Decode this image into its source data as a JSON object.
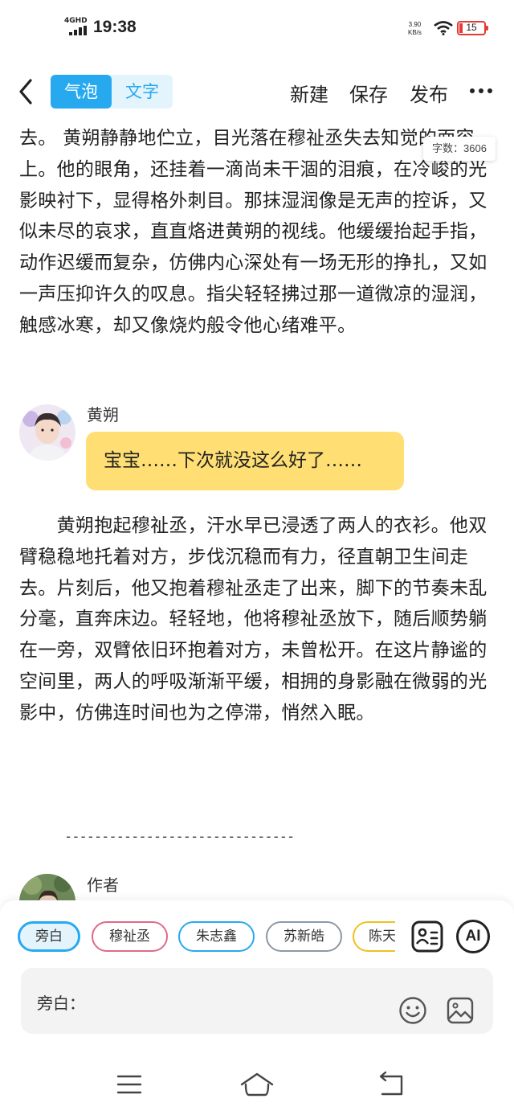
{
  "status_bar": {
    "network": "4GHD",
    "time": "19:38",
    "speed_value": "3.90",
    "speed_unit": "KB/s",
    "battery": "15",
    "battery_color": "#e53935"
  },
  "header": {
    "tab_bubble": "气泡",
    "tab_text": "文字",
    "new_label": "新建",
    "save_label": "保存",
    "publish_label": "发布",
    "accent_color": "#27a9f0"
  },
  "content": {
    "word_count": "字数：3606",
    "para1": "去。 黄朔静静地伫立，目光落在穆祉丞失去知觉的面容上。他的眼角，还挂着一滴尚未干涸的泪痕，在冷峻的光影映衬下，显得格外刺目。那抹湿润像是无声的控诉，又似未尽的哀求，直直烙进黄朔的视线。他缓缓抬起手指，动作迟缓而复杂，仿佛内心深处有一场无形的挣扎，又如一声压抑许久的叹息。指尖轻轻拂过那一道微凉的湿润，触感冰寒，却又像烧灼般令他心绪难平。",
    "speaker1": "黄朔",
    "bubble1": "宝宝……下次就没这么好了……",
    "bubble_color": "#ffdf73",
    "para2": "　　黄朔抱起穆祉丞，汗水早已浸透了两人的衣衫。他双臂稳稳地托着对方，步伐沉稳而有力，径直朝卫生间走去。片刻后，他又抱着穆祉丞走了出来，脚下的节奏未乱分毫，直奔床边。轻轻地，他将穆祉丞放下，随后顺势躺在一旁，双臂依旧环抱着对方，未曾松开。在这片静谧的空间里，两人的呼吸渐渐平缓，相拥的身影融在微弱的光影中，仿佛连时间也为之停滞，悄然入眠。",
    "divider": "-------------------------------",
    "speaker2": "作者"
  },
  "roles": [
    {
      "label": "旁白",
      "color": "#27a9f0"
    },
    {
      "label": "穆祉丞",
      "color": "#e06a8a"
    },
    {
      "label": "朱志鑫",
      "color": "#27a9f0"
    },
    {
      "label": "苏新皓",
      "color": "#8a9aa8"
    },
    {
      "label": "陈天",
      "color": "#f0c020"
    }
  ],
  "input": {
    "label": "旁白："
  },
  "icons": {
    "back": "chevron-left-icon",
    "more": "more-horizontal-icon",
    "contact_card": "contact-card-icon",
    "ai": "ai-icon",
    "emoji": "emoji-icon",
    "image": "image-icon",
    "nav_menu": "menu-icon",
    "nav_home": "home-icon",
    "nav_back": "back-icon"
  },
  "ai_label": "AI"
}
